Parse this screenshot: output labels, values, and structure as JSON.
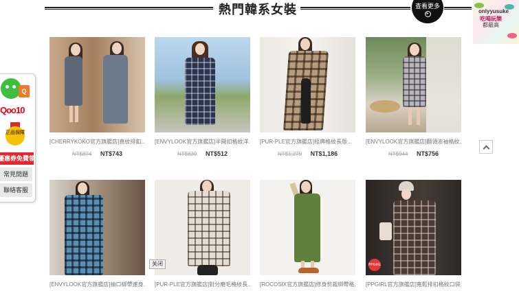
{
  "section": {
    "title": "熱門韓系女裝",
    "more_label": "查看更多",
    "more_arrow": "▸"
  },
  "ad": {
    "line1": "onlyyusuke",
    "line2": "吃喝玩樂",
    "line3": "都最高"
  },
  "sidebar": {
    "bag_label": "Q",
    "logo": "Qoo10",
    "medal_text": "正品保障",
    "coupon_label": "優惠券免費領",
    "faq_label": "常見問題",
    "contact_label": "聯絡客服"
  },
  "products": [
    {
      "name": "[CHERRYKOKO官方旗艦店]直紋排釦...",
      "old_price": "NT$874",
      "price": "NT$743"
    },
    {
      "name": "[ENVYLOOK官方旗艦店]半開扣格紋洋...",
      "old_price": "NT$639",
      "price": "NT$512"
    },
    {
      "name": "[PUR-PLE官方旗艦店]經典格紋長版...",
      "old_price": "NT$1,279",
      "price": "NT$1,186"
    },
    {
      "name": "[ENVYLOOK官方旗艦店]翻領澎袖格紋...",
      "old_price": "NT$944",
      "price": "NT$756"
    },
    {
      "name": "[ENVYLOOK官方旗艦店]抽口綁帶連身...",
      "old_price": "",
      "price": ""
    },
    {
      "name": "[PUR-PLE官方旗艦店]對分磨毛格紋長...",
      "old_price": "",
      "price": ""
    },
    {
      "name": "[ROCOSIX官方旗艦店]修身剪裁綁帶格...",
      "old_price": "",
      "price": ""
    },
    {
      "name": "[PPGIRL官方旗艦店]寬鬆排扣格紋口袋...",
      "old_price": "",
      "price": ""
    }
  ],
  "close_label": "关闭",
  "badge_label": "PPGIRL"
}
